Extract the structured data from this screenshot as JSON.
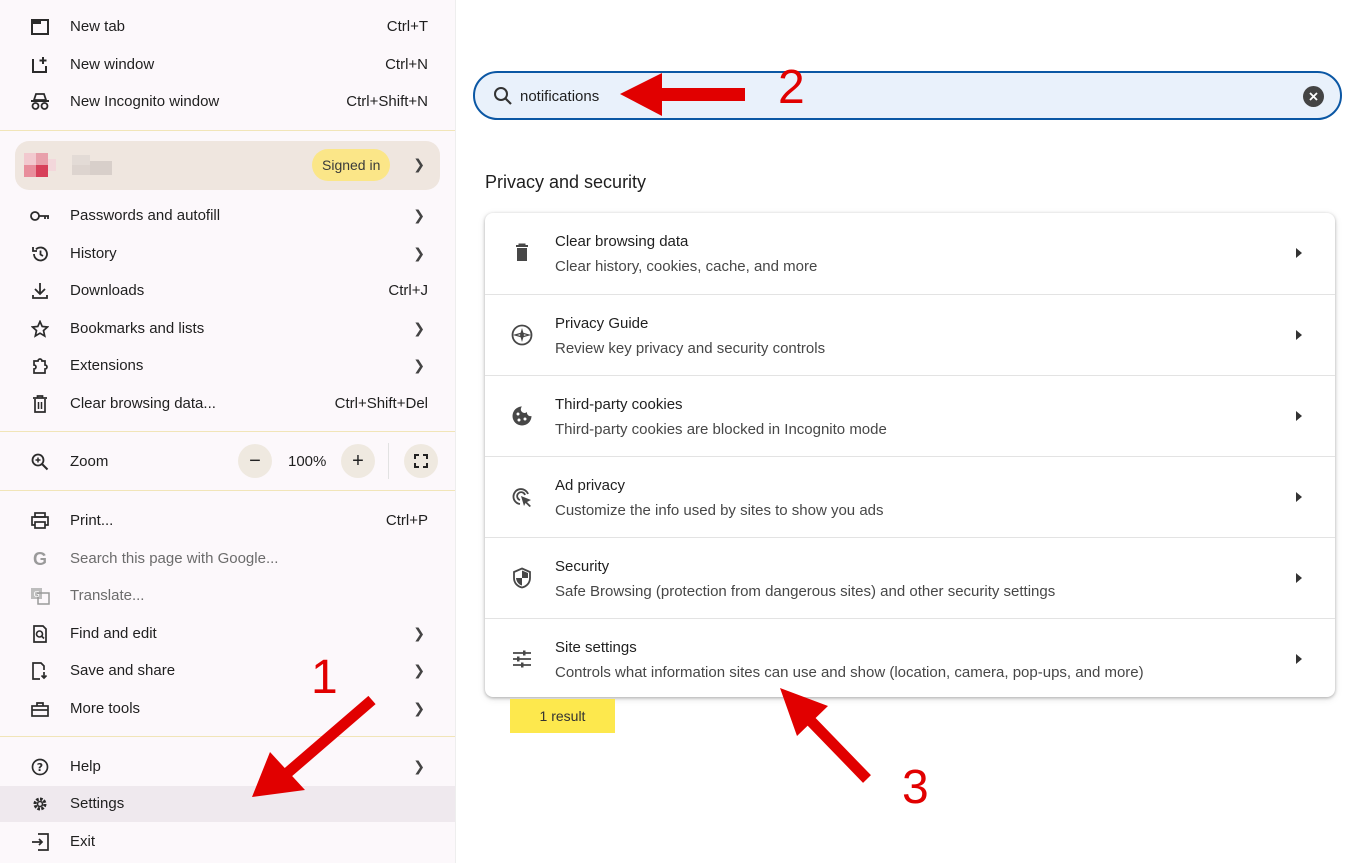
{
  "menu": {
    "items": [
      {
        "label": "New tab",
        "shortcut": "Ctrl+T"
      },
      {
        "label": "New window",
        "shortcut": "Ctrl+N"
      },
      {
        "label": "New Incognito window",
        "shortcut": "Ctrl+Shift+N"
      }
    ],
    "profile": {
      "badge": "Signed in"
    },
    "items2": [
      {
        "label": "Passwords and autofill"
      },
      {
        "label": "History"
      },
      {
        "label": "Downloads",
        "shortcut": "Ctrl+J"
      },
      {
        "label": "Bookmarks and lists"
      },
      {
        "label": "Extensions"
      },
      {
        "label": "Clear browsing data...",
        "shortcut": "Ctrl+Shift+Del"
      }
    ],
    "zoom": {
      "label": "Zoom",
      "value": "100%",
      "minus": "−",
      "plus": "+"
    },
    "items3": [
      {
        "label": "Print...",
        "shortcut": "Ctrl+P"
      },
      {
        "label": "Search this page with Google..."
      },
      {
        "label": "Translate..."
      },
      {
        "label": "Find and edit"
      },
      {
        "label": "Save and share"
      },
      {
        "label": "More tools"
      }
    ],
    "items4": [
      {
        "label": "Help"
      },
      {
        "label": "Settings"
      },
      {
        "label": "Exit"
      }
    ]
  },
  "search": {
    "value": "notifications"
  },
  "section": {
    "title": "Privacy and security"
  },
  "rows": [
    {
      "title": "Clear browsing data",
      "subtitle": "Clear history, cookies, cache, and more"
    },
    {
      "title": "Privacy Guide",
      "subtitle": "Review key privacy and security controls"
    },
    {
      "title": "Third-party cookies",
      "subtitle": "Third-party cookies are blocked in Incognito mode"
    },
    {
      "title": "Ad privacy",
      "subtitle": "Customize the info used by sites to show you ads"
    },
    {
      "title": "Security",
      "subtitle": "Safe Browsing (protection from dangerous sites) and other security settings"
    },
    {
      "title": "Site settings",
      "subtitle": "Controls what information sites can use and show (location, camera, pop-ups, and more)"
    }
  ],
  "result": "1 result",
  "annotations": {
    "a1": "1",
    "a2": "2",
    "a3": "3"
  },
  "colors": {
    "accent": "#0b57a4",
    "annotation": "#e10000",
    "highlight": "#fde84d",
    "badge": "#fbe688"
  }
}
